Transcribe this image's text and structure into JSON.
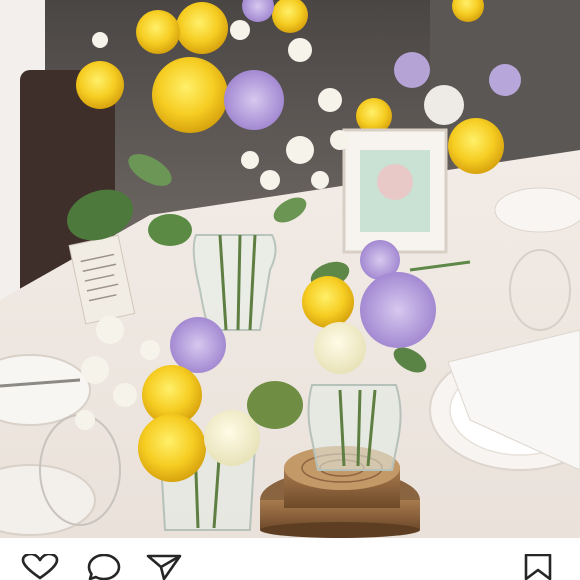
{
  "post": {
    "image": {
      "subject": "wedding-table-flower-centerpiece"
    },
    "actions": [
      {
        "name": "like",
        "icon": "heart-icon"
      },
      {
        "name": "comment",
        "icon": "comment-icon"
      },
      {
        "name": "share",
        "icon": "send-icon"
      },
      {
        "name": "save",
        "icon": "bookmark-icon"
      }
    ]
  },
  "colors": {
    "background": "#ffffff",
    "icon_stroke": "#262626"
  }
}
